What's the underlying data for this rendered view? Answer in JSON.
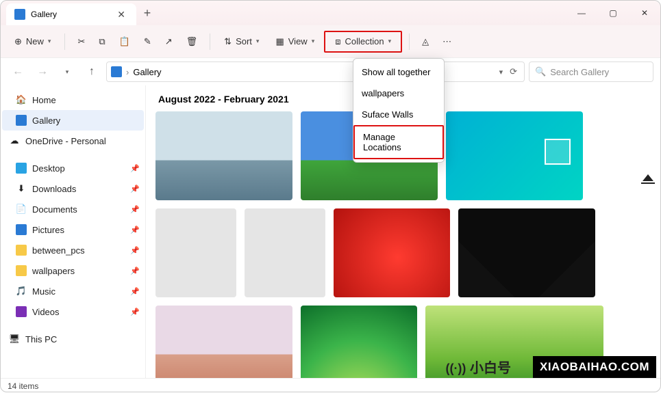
{
  "window": {
    "tab_title": "Gallery",
    "new_button": "New",
    "sort_button": "Sort",
    "view_button": "View",
    "collection_button": "Collection",
    "breadcrumb": "Gallery",
    "search_placeholder": "Search Gallery"
  },
  "collection_menu": {
    "items": [
      "Show all together",
      "wallpapers",
      "Suface Walls",
      "Manage Locations"
    ]
  },
  "sidebar": {
    "home": "Home",
    "gallery": "Gallery",
    "onedrive": "OneDrive - Personal",
    "desktop": "Desktop",
    "downloads": "Downloads",
    "documents": "Documents",
    "pictures": "Pictures",
    "between_pcs": "between_pcs",
    "wallpapers": "wallpapers",
    "music": "Music",
    "videos": "Videos",
    "this_pc": "This PC"
  },
  "content": {
    "section_title": "August 2022 - February 2021"
  },
  "status": {
    "items_text": "14 items"
  },
  "watermark": {
    "logo_text": "小白号",
    "badge_text": "XIAOBAIHAO.COM"
  }
}
